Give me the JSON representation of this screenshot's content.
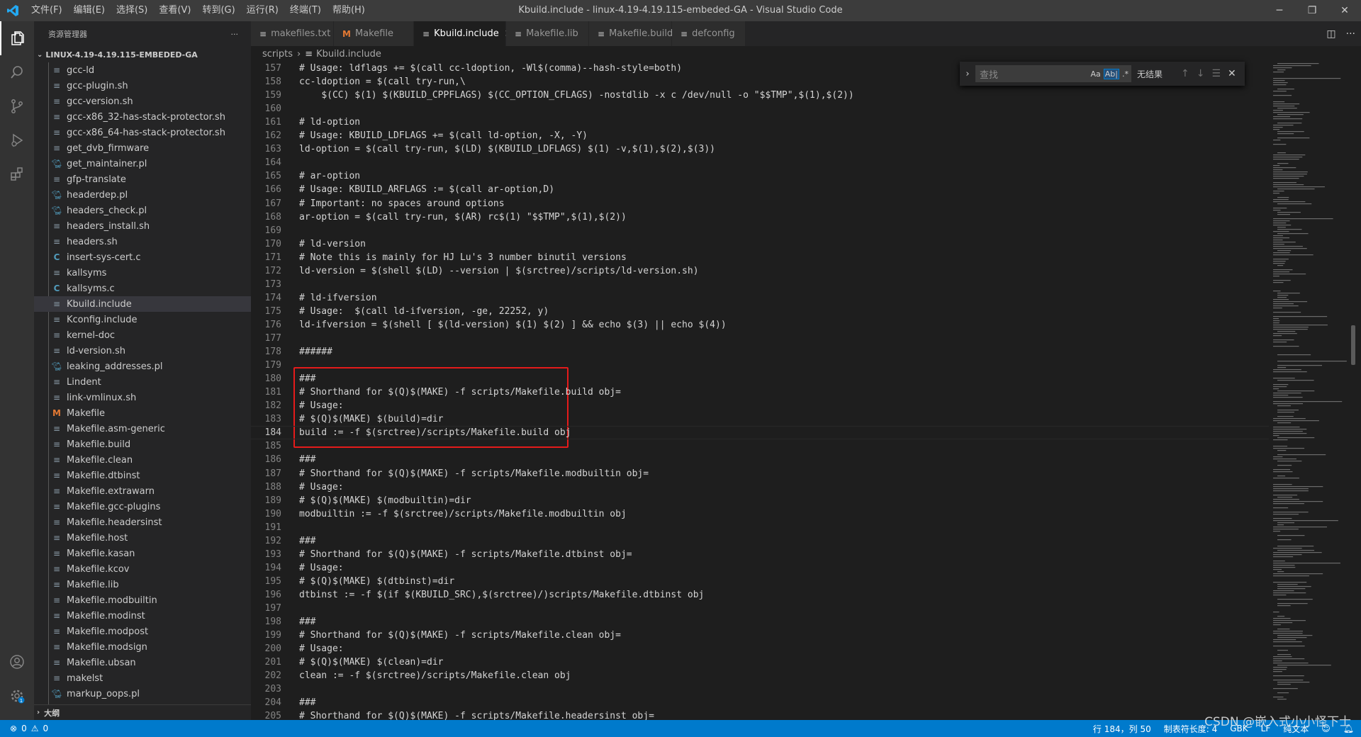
{
  "titlebar": {
    "menus": [
      "文件(F)",
      "编辑(E)",
      "选择(S)",
      "查看(V)",
      "转到(G)",
      "运行(R)",
      "终端(T)",
      "帮助(H)"
    ],
    "title": "Kbuild.include - linux-4.19-4.19.115-embeded-GA - Visual Studio Code"
  },
  "sidebar": {
    "header": "资源管理器",
    "more": "···",
    "root": "LINUX-4.19-4.19.115-EMBEDED-GA",
    "outline": "大纲",
    "files": [
      {
        "name": "gcc-ld",
        "icon": "file"
      },
      {
        "name": "gcc-plugin.sh",
        "icon": "file"
      },
      {
        "name": "gcc-version.sh",
        "icon": "file"
      },
      {
        "name": "gcc-x86_32-has-stack-protector.sh",
        "icon": "file"
      },
      {
        "name": "gcc-x86_64-has-stack-protector.sh",
        "icon": "file"
      },
      {
        "name": "get_dvb_firmware",
        "icon": "file"
      },
      {
        "name": "get_maintainer.pl",
        "icon": "perl"
      },
      {
        "name": "gfp-translate",
        "icon": "file"
      },
      {
        "name": "headerdep.pl",
        "icon": "perl"
      },
      {
        "name": "headers_check.pl",
        "icon": "perl"
      },
      {
        "name": "headers_install.sh",
        "icon": "file"
      },
      {
        "name": "headers.sh",
        "icon": "file"
      },
      {
        "name": "insert-sys-cert.c",
        "icon": "c"
      },
      {
        "name": "kallsyms",
        "icon": "file"
      },
      {
        "name": "kallsyms.c",
        "icon": "c"
      },
      {
        "name": "Kbuild.include",
        "icon": "file"
      },
      {
        "name": "Kconfig.include",
        "icon": "file"
      },
      {
        "name": "kernel-doc",
        "icon": "file"
      },
      {
        "name": "ld-version.sh",
        "icon": "file"
      },
      {
        "name": "leaking_addresses.pl",
        "icon": "perl"
      },
      {
        "name": "Lindent",
        "icon": "file"
      },
      {
        "name": "link-vmlinux.sh",
        "icon": "file"
      },
      {
        "name": "Makefile",
        "icon": "makefile"
      },
      {
        "name": "Makefile.asm-generic",
        "icon": "file"
      },
      {
        "name": "Makefile.build",
        "icon": "file"
      },
      {
        "name": "Makefile.clean",
        "icon": "file"
      },
      {
        "name": "Makefile.dtbinst",
        "icon": "file"
      },
      {
        "name": "Makefile.extrawarn",
        "icon": "file"
      },
      {
        "name": "Makefile.gcc-plugins",
        "icon": "file"
      },
      {
        "name": "Makefile.headersinst",
        "icon": "file"
      },
      {
        "name": "Makefile.host",
        "icon": "file"
      },
      {
        "name": "Makefile.kasan",
        "icon": "file"
      },
      {
        "name": "Makefile.kcov",
        "icon": "file"
      },
      {
        "name": "Makefile.lib",
        "icon": "file"
      },
      {
        "name": "Makefile.modbuiltin",
        "icon": "file"
      },
      {
        "name": "Makefile.modinst",
        "icon": "file"
      },
      {
        "name": "Makefile.modpost",
        "icon": "file"
      },
      {
        "name": "Makefile.modsign",
        "icon": "file"
      },
      {
        "name": "Makefile.ubsan",
        "icon": "file"
      },
      {
        "name": "makelst",
        "icon": "file"
      },
      {
        "name": "markup_oops.pl",
        "icon": "perl"
      }
    ],
    "selected": "Kbuild.include"
  },
  "tabs": [
    {
      "label": "makefiles.txt",
      "icon": "file",
      "active": false
    },
    {
      "label": "Makefile",
      "icon": "makefile",
      "active": false
    },
    {
      "label": "Kbuild.include",
      "icon": "file",
      "active": true
    },
    {
      "label": "Makefile.lib",
      "icon": "file",
      "active": false
    },
    {
      "label": "Makefile.build",
      "icon": "file",
      "active": false
    },
    {
      "label": "defconfig",
      "icon": "file",
      "active": false
    }
  ],
  "breadcrumb": [
    "scripts",
    "Kbuild.include"
  ],
  "find": {
    "placeholder": "查找",
    "opt_case": "Aa",
    "opt_word": "Ab|",
    "opt_regex": ".*",
    "result": "无结果"
  },
  "editor": {
    "current_line": 184,
    "lines": [
      {
        "n": 157,
        "t": "# Usage: ldflags += $(call cc-ldoption, -Wl$(comma)--hash-style=both)"
      },
      {
        "n": 158,
        "t": "cc-ldoption = $(call try-run,\\"
      },
      {
        "n": 159,
        "t": "\t$(CC) $(1) $(KBUILD_CPPFLAGS) $(CC_OPTION_CFLAGS) -nostdlib -x c /dev/null -o \"$$TMP\",$(1),$(2))"
      },
      {
        "n": 160,
        "t": ""
      },
      {
        "n": 161,
        "t": "# ld-option"
      },
      {
        "n": 162,
        "t": "# Usage: KBUILD_LDFLAGS += $(call ld-option, -X, -Y)"
      },
      {
        "n": 163,
        "t": "ld-option = $(call try-run, $(LD) $(KBUILD_LDFLAGS) $(1) -v,$(1),$(2),$(3))"
      },
      {
        "n": 164,
        "t": ""
      },
      {
        "n": 165,
        "t": "# ar-option"
      },
      {
        "n": 166,
        "t": "# Usage: KBUILD_ARFLAGS := $(call ar-option,D)"
      },
      {
        "n": 167,
        "t": "# Important: no spaces around options"
      },
      {
        "n": 168,
        "t": "ar-option = $(call try-run, $(AR) rc$(1) \"$$TMP\",$(1),$(2))"
      },
      {
        "n": 169,
        "t": ""
      },
      {
        "n": 170,
        "t": "# ld-version"
      },
      {
        "n": 171,
        "t": "# Note this is mainly for HJ Lu's 3 number binutil versions"
      },
      {
        "n": 172,
        "t": "ld-version = $(shell $(LD) --version | $(srctree)/scripts/ld-version.sh)"
      },
      {
        "n": 173,
        "t": ""
      },
      {
        "n": 174,
        "t": "# ld-ifversion"
      },
      {
        "n": 175,
        "t": "# Usage:  $(call ld-ifversion, -ge, 22252, y)"
      },
      {
        "n": 176,
        "t": "ld-ifversion = $(shell [ $(ld-version) $(1) $(2) ] && echo $(3) || echo $(4))"
      },
      {
        "n": 177,
        "t": ""
      },
      {
        "n": 178,
        "t": "######"
      },
      {
        "n": 179,
        "t": ""
      },
      {
        "n": 180,
        "t": "###"
      },
      {
        "n": 181,
        "t": "# Shorthand for $(Q)$(MAKE) -f scripts/Makefile.build obj="
      },
      {
        "n": 182,
        "t": "# Usage:"
      },
      {
        "n": 183,
        "t": "# $(Q)$(MAKE) $(build)=dir"
      },
      {
        "n": 184,
        "t": "build := -f $(srctree)/scripts/Makefile.build obj"
      },
      {
        "n": 185,
        "t": ""
      },
      {
        "n": 186,
        "t": "###"
      },
      {
        "n": 187,
        "t": "# Shorthand for $(Q)$(MAKE) -f scripts/Makefile.modbuiltin obj="
      },
      {
        "n": 188,
        "t": "# Usage:"
      },
      {
        "n": 189,
        "t": "# $(Q)$(MAKE) $(modbuiltin)=dir"
      },
      {
        "n": 190,
        "t": "modbuiltin := -f $(srctree)/scripts/Makefile.modbuiltin obj"
      },
      {
        "n": 191,
        "t": ""
      },
      {
        "n": 192,
        "t": "###"
      },
      {
        "n": 193,
        "t": "# Shorthand for $(Q)$(MAKE) -f scripts/Makefile.dtbinst obj="
      },
      {
        "n": 194,
        "t": "# Usage:"
      },
      {
        "n": 195,
        "t": "# $(Q)$(MAKE) $(dtbinst)=dir"
      },
      {
        "n": 196,
        "t": "dtbinst := -f $(if $(KBUILD_SRC),$(srctree)/)scripts/Makefile.dtbinst obj"
      },
      {
        "n": 197,
        "t": ""
      },
      {
        "n": 198,
        "t": "###"
      },
      {
        "n": 199,
        "t": "# Shorthand for $(Q)$(MAKE) -f scripts/Makefile.clean obj="
      },
      {
        "n": 200,
        "t": "# Usage:"
      },
      {
        "n": 201,
        "t": "# $(Q)$(MAKE) $(clean)=dir"
      },
      {
        "n": 202,
        "t": "clean := -f $(srctree)/scripts/Makefile.clean obj"
      },
      {
        "n": 203,
        "t": ""
      },
      {
        "n": 204,
        "t": "###"
      },
      {
        "n": 205,
        "t": "# Shorthand for $(Q)$(MAKE) -f scripts/Makefile.headersinst obj="
      }
    ]
  },
  "statusbar": {
    "errors": "0",
    "warnings": "0",
    "position": "行 184，列 50",
    "tabsize": "制表符长度: 4",
    "encoding": "GBK",
    "eol": "LF",
    "language": "纯文本",
    "watermark": "CSDN @嵌入式小小怪下士"
  },
  "colors": {
    "accent": "#007acc",
    "highlight_box": "#e51b1b"
  }
}
